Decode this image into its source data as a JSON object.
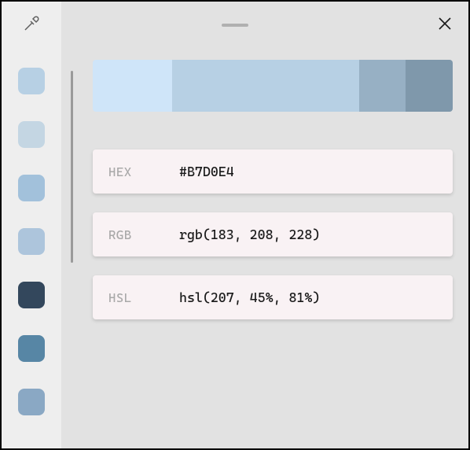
{
  "shades": [
    {
      "color": "#cfe5f9",
      "weight": 22
    },
    {
      "color": "#b7d0e4",
      "weight": 52
    },
    {
      "color": "#97b0c4",
      "weight": 13
    },
    {
      "color": "#7f98ab",
      "weight": 13
    }
  ],
  "sidebar_swatches": [
    "#b7d0e4",
    "#c4d6e3",
    "#a2c1db",
    "#adc5dc",
    "#33475c",
    "#5786a5",
    "#8aa8c4"
  ],
  "codes": {
    "hex": {
      "label": "HEX",
      "value": "#B7D0E4"
    },
    "rgb": {
      "label": "RGB",
      "value": "rgb(183, 208, 228)"
    },
    "hsl": {
      "label": "HSL",
      "value": "hsl(207, 45%, 81%)"
    }
  }
}
